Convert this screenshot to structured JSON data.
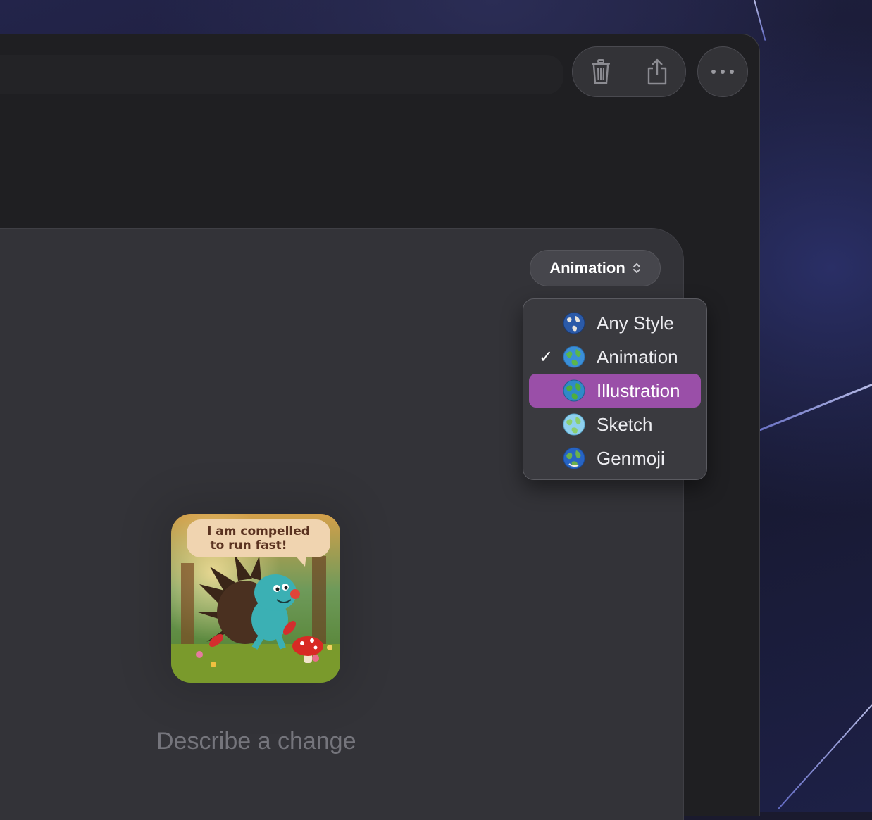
{
  "toolbar": {
    "delete_icon": "trash-icon",
    "share_icon": "share-icon",
    "more_icon": "ellipsis-icon"
  },
  "style_picker": {
    "selected": "Animation",
    "options": [
      {
        "label": "Any Style",
        "checked": false,
        "highlighted": false
      },
      {
        "label": "Animation",
        "checked": true,
        "highlighted": false
      },
      {
        "label": "Illustration",
        "checked": false,
        "highlighted": true
      },
      {
        "label": "Sketch",
        "checked": false,
        "highlighted": false
      },
      {
        "label": "Genmoji",
        "checked": false,
        "highlighted": false
      }
    ],
    "check_mark": "✓",
    "highlight_color": "#9a4fa8"
  },
  "image": {
    "speech_bubble_line1": "I am compelled",
    "speech_bubble_line2": "to run fast!"
  },
  "prompt": {
    "placeholder": "Describe a change"
  }
}
